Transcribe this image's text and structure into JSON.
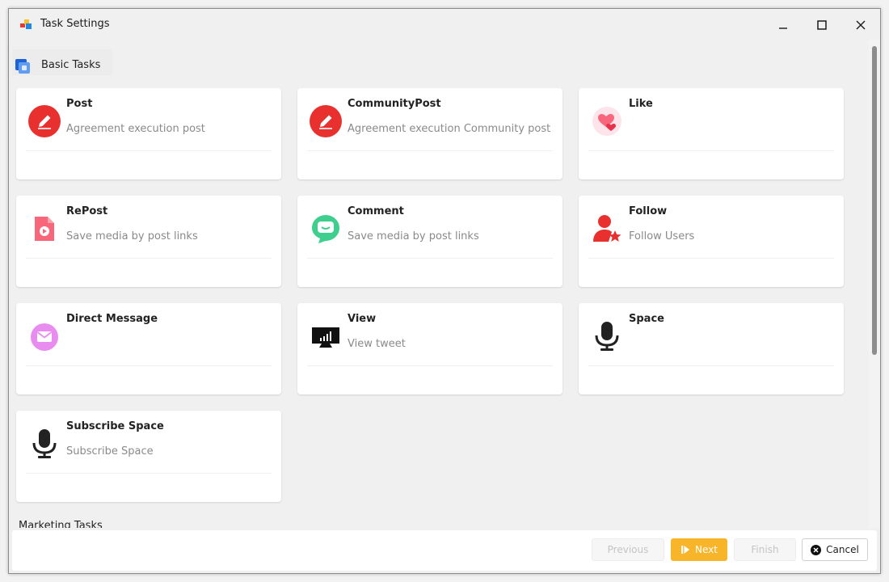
{
  "window": {
    "title": "Task Settings"
  },
  "sections": {
    "basic": "Basic Tasks",
    "marketing": "Marketing Tasks"
  },
  "cards": [
    {
      "title": "Post",
      "desc": "Agreement execution post",
      "icon": "edit-icon"
    },
    {
      "title": "CommunityPost",
      "desc": "Agreement execution Community post",
      "icon": "edit-icon"
    },
    {
      "title": "Like",
      "desc": "",
      "icon": "hearts-icon"
    },
    {
      "title": "RePost",
      "desc": "Save media by post links",
      "icon": "video-file-icon"
    },
    {
      "title": "Comment",
      "desc": "Save media by post links",
      "icon": "chat-bubble-icon"
    },
    {
      "title": "Follow",
      "desc": "Follow Users",
      "icon": "user-star-icon"
    },
    {
      "title": "Direct Message",
      "desc": "",
      "icon": "mail-icon"
    },
    {
      "title": "View",
      "desc": "View tweet",
      "icon": "monitor-chart-icon"
    },
    {
      "title": "Space",
      "desc": "",
      "icon": "microphone-icon"
    },
    {
      "title": "Subscribe Space",
      "desc": "Subscribe Space",
      "icon": "microphone-icon"
    }
  ],
  "footer": {
    "previous": "Previous",
    "next": "Next",
    "finish": "Finish",
    "cancel": "Cancel"
  },
  "colors": {
    "accent": "#f8b52a",
    "red": "#e8312f",
    "green": "#3ecf8e",
    "purple": "#e98cf0",
    "pink": "#f7667a"
  }
}
